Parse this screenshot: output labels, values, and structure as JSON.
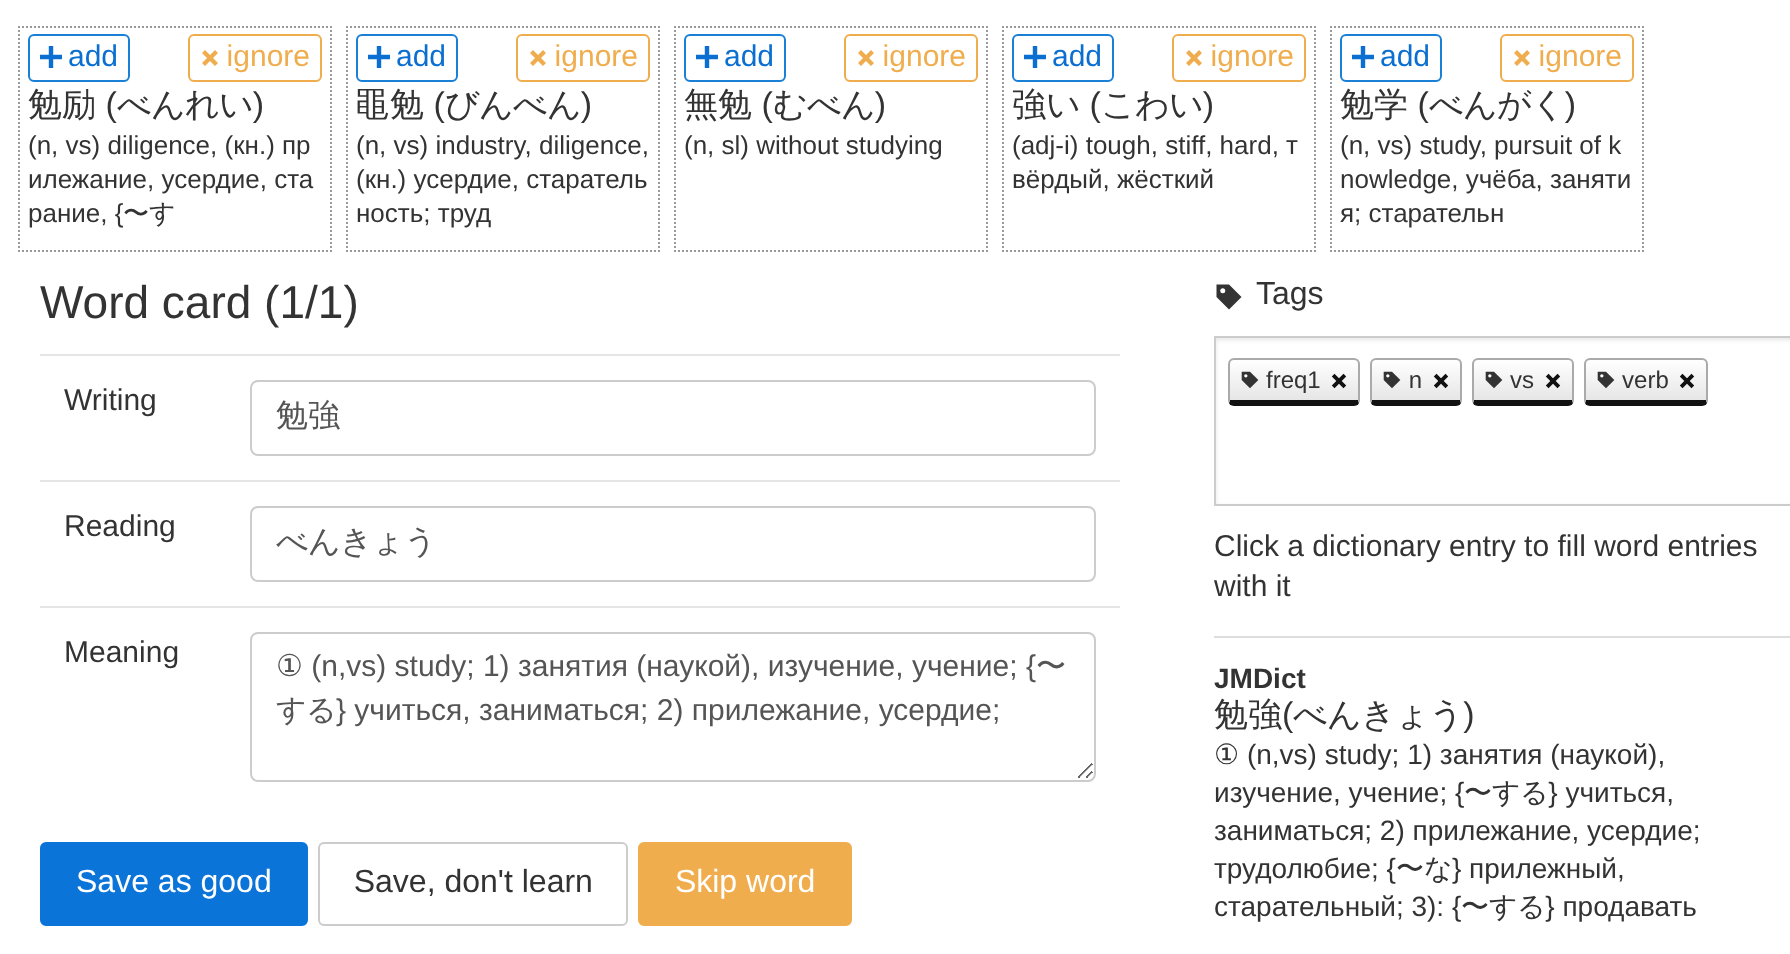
{
  "candidates": [
    {
      "add_label": "add",
      "ignore_label": "ignore",
      "headword": "勉励 (べんれい)",
      "definition": "(n, vs) diligence, (кн.) прилежание, усердие, старание, {〜す"
    },
    {
      "add_label": "add",
      "ignore_label": "ignore",
      "headword": "黽勉 (びんべん)",
      "definition": "(n, vs) industry, diligence, (кн.) усердие, старательность; труд"
    },
    {
      "add_label": "add",
      "ignore_label": "ignore",
      "headword": "無勉 (むべん)",
      "definition": "(n, sl) without studying"
    },
    {
      "add_label": "add",
      "ignore_label": "ignore",
      "headword": "強い (こわい)",
      "definition": "(adj-i) tough, stiff, hard, твёрдый, жёсткий"
    },
    {
      "add_label": "add",
      "ignore_label": "ignore",
      "headword": "勉学 (べんがく)",
      "definition": "(n, vs) study, pursuit of knowledge, учёба, занятия; старательн"
    }
  ],
  "word_card": {
    "title": "Word card (1/1)",
    "fields": [
      {
        "label": "Writing",
        "kind": "input",
        "value": "勉強"
      },
      {
        "label": "Reading",
        "kind": "input",
        "value": "べんきょう"
      },
      {
        "label": "Meaning",
        "kind": "textarea",
        "value": "① (n,vs) study; 1) занятия (наукой), изучение, учение; {〜する} учиться, заниматься; 2) прилежание, усердие;"
      }
    ]
  },
  "buttons": [
    {
      "label": "Save as good",
      "kind": "primary"
    },
    {
      "label": "Save, don't learn",
      "kind": "default"
    },
    {
      "label": "Skip word",
      "kind": "warning"
    }
  ],
  "tags": {
    "title": "Tags",
    "items": [
      "freq1",
      "n",
      "vs",
      "verb"
    ]
  },
  "hint": "Click a dictionary entry to fill word entries with it",
  "dictionary": {
    "source": "JMDict",
    "headword": "勉強(べんきょう)",
    "definition": "① (n,vs) study; 1) занятия (наукой), изучение, учение; {〜する} учиться, заниматься; 2) прилежание, усердие; трудолюбие; {〜な} прилежный, старательный; 3): {〜する} продавать"
  }
}
